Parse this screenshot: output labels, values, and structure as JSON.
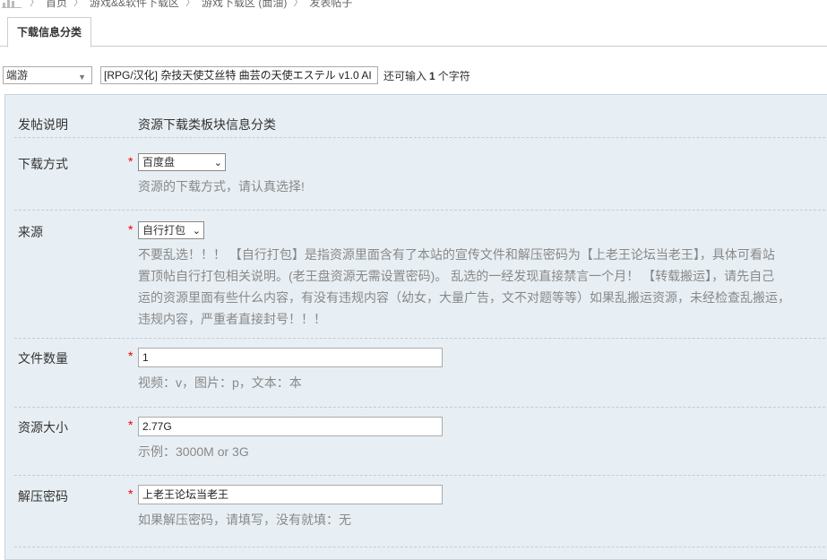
{
  "breadcrumb": [
    "首页",
    "游戏&&软件下载区",
    "游戏下载区 (面油)",
    "发表帖子"
  ],
  "tabs": [
    {
      "label": "下载信息分类"
    }
  ],
  "subject": {
    "type_value": "端游",
    "title_value": "[RPG/汉化] 杂技天使艾丝特 曲芸の天使エステル v1.0 AI",
    "remain_prefix": "还可输入",
    "remain_count": "1",
    "remain_suffix": "个字符"
  },
  "form": {
    "intro": {
      "label": "发帖说明",
      "text": "资源下载类板块信息分类"
    },
    "download": {
      "label": "下载方式",
      "value": "百度盘",
      "hint": "资源的下载方式，请认真选择!"
    },
    "source": {
      "label": "来源",
      "value": "自行打包",
      "hint_lines": [
        "不要乱选！！！ 【自行打包】是指资源里面含有了本站的宣传文件和解压密码为【上老王论坛当老王】，具体可看站",
        "置顶帖自行打包相关说明。(老王盘资源无需设置密码)。 乱选的一经发现直接禁言一个月！ 【转载搬运】，请先自己",
        "运的资源里面有些什么内容，有没有违规内容（幼女，大量广告，文不对题等等）如果乱搬运资源，未经检查乱搬运，",
        "违规内容，严重者直接封号！！！"
      ]
    },
    "filecount": {
      "label": "文件数量",
      "value": "1",
      "hint": "视频：v，图片：p，文本：本"
    },
    "size": {
      "label": "资源大小",
      "value": "2.77G",
      "hint": "示例：3000M or 3G"
    },
    "password": {
      "label": "解压密码",
      "value": "上老王论坛当老王",
      "hint": "如果解压密码，请填写，没有就填：无"
    }
  },
  "required_mark": "*",
  "colors": {
    "panel_bg": "#e8eff4",
    "required": "#ee0000",
    "hint": "#888888"
  }
}
